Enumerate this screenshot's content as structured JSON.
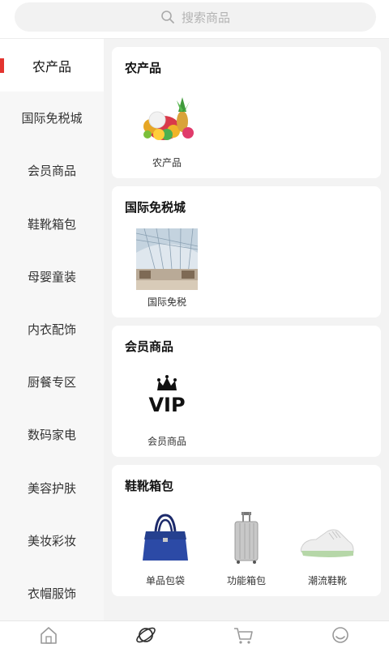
{
  "search": {
    "placeholder": "搜索商品",
    "icon": "search-icon"
  },
  "sidebar": {
    "items": [
      {
        "label": "农产品",
        "active": true
      },
      {
        "label": "国际免税城"
      },
      {
        "label": "会员商品"
      },
      {
        "label": "鞋靴箱包"
      },
      {
        "label": "母婴童装"
      },
      {
        "label": "内衣配饰"
      },
      {
        "label": "厨餐专区"
      },
      {
        "label": "数码家电"
      },
      {
        "label": "美容护肤"
      },
      {
        "label": "美妆彩妆"
      },
      {
        "label": "衣帽服饰"
      }
    ]
  },
  "sections": [
    {
      "title": "农产品",
      "items": [
        {
          "label": "农产品",
          "image": "fruit-basket"
        }
      ]
    },
    {
      "title": "国际免税城",
      "items": [
        {
          "label": "国际免税",
          "image": "mall-interior"
        }
      ]
    },
    {
      "title": "会员商品",
      "items": [
        {
          "label": "会员商品",
          "image": "vip-crown"
        }
      ]
    },
    {
      "title": "鞋靴箱包",
      "items": [
        {
          "label": "单品包袋",
          "image": "handbag"
        },
        {
          "label": "功能箱包",
          "image": "suitcase"
        },
        {
          "label": "潮流鞋靴",
          "image": "sneaker"
        }
      ]
    }
  ],
  "tabbar": {
    "tabs": [
      {
        "icon": "home-icon"
      },
      {
        "icon": "category-icon",
        "active": true
      },
      {
        "icon": "cart-icon"
      },
      {
        "icon": "profile-icon"
      }
    ]
  },
  "colors": {
    "accent": "#e3342f",
    "sidebar_bg": "#f7f7f7",
    "content_bg": "#f3f3f3"
  }
}
